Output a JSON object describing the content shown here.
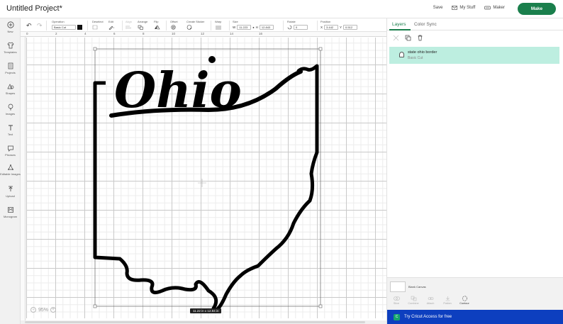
{
  "header": {
    "title": "Untitled Project*",
    "save_label": "Save",
    "my_stuff_label": "My Stuff",
    "maker_label": "Maker",
    "make_label": "Make"
  },
  "toolbar": {
    "operation_label": "Operation",
    "operation_value": "Basic Cut",
    "deselect_label": "Deselect",
    "edit_label": "Edit",
    "align_label": "Align",
    "arrange_label": "Arrange",
    "flip_label": "Flip",
    "offset_label": "Offset",
    "create_sticker_label": "Create Sticker",
    "warp_label": "Warp",
    "size_label": "Size",
    "size_w_label": "W",
    "size_w_value": "11.223",
    "size_h_label": "H",
    "size_h_value": "12.843",
    "rotate_label": "Rotate",
    "rotate_value": "0",
    "position_label": "Position",
    "pos_x_label": "X",
    "pos_x_value": "3.442",
    "pos_y_label": "Y",
    "pos_y_value": "0.512"
  },
  "sidebar": {
    "items": [
      {
        "label": "New",
        "icon": "plus-circle-icon"
      },
      {
        "label": "Templates",
        "icon": "shirt-icon"
      },
      {
        "label": "Projects",
        "icon": "projects-icon"
      },
      {
        "label": "Shapes",
        "icon": "shapes-icon"
      },
      {
        "label": "Images",
        "icon": "lightbulb-icon"
      },
      {
        "label": "Text",
        "icon": "text-icon"
      },
      {
        "label": "Phrases",
        "icon": "speech-bubble-icon"
      },
      {
        "label": "Editable Images",
        "icon": "editable-images-icon"
      },
      {
        "label": "Upload",
        "icon": "upload-icon"
      },
      {
        "label": "Monogram",
        "icon": "monogram-icon"
      }
    ]
  },
  "canvas": {
    "ruler_top": [
      "0",
      "2",
      "4",
      "6",
      "8",
      "10",
      "12",
      "14",
      "16"
    ],
    "zoom_value": "95%",
    "dimension_tag": "11.22  in x 12.84  in",
    "artwork_text": "Ohio"
  },
  "panel": {
    "tab_layers": "Layers",
    "tab_color_sync": "Color Sync",
    "layer_name": "state ohio border",
    "layer_type": "Basic Cut",
    "blank_canvas_label": "Blank Canvas",
    "tools": [
      {
        "label": "Slice",
        "enabled": false
      },
      {
        "label": "Combine",
        "enabled": false
      },
      {
        "label": "Attach",
        "enabled": false
      },
      {
        "label": "Flatten",
        "enabled": false
      },
      {
        "label": "Contour",
        "enabled": true
      }
    ],
    "access_text": "Try Cricut Access for free"
  },
  "colors": {
    "brand_green": "#1a7f4c",
    "layer_selected": "#bdeee0",
    "access_blue": "#0d3fbf"
  }
}
